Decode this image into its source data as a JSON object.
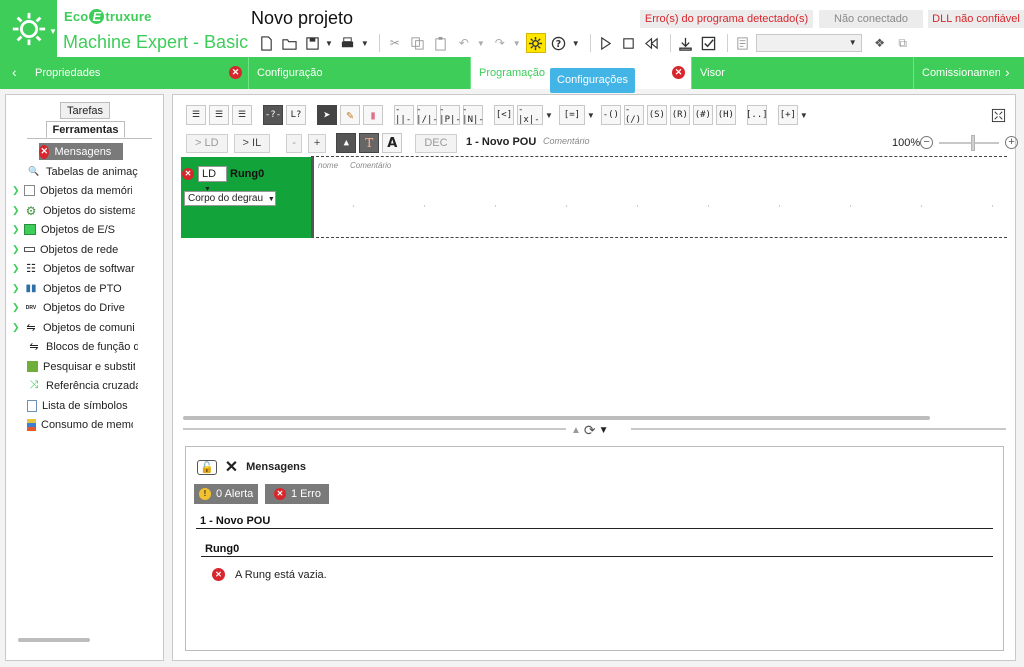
{
  "header": {
    "brand": {
      "pre": "Eco",
      "mark": "E",
      "post": "truxure"
    },
    "product": "Machine Expert - Basic",
    "project_title": "Novo projeto",
    "status": {
      "program_errors": "Erro(s) do programa detectado(s)",
      "connection": "Não conectado",
      "dll": "DLL não confiável"
    },
    "colors": {
      "accent": "#3dcd58",
      "error": "#d8262d",
      "highlight": "#ffe600",
      "info": "#42b4e6"
    }
  },
  "tabs": [
    {
      "label": "Propriedades",
      "error": true
    },
    {
      "label": "Configuração",
      "error": false
    },
    {
      "label": "Programação",
      "error": true,
      "active": true
    },
    {
      "label": "Visor",
      "error": false
    },
    {
      "label": "Comissionament",
      "error": false
    }
  ],
  "tooltip": "Configurações",
  "left_panel": {
    "tabs": {
      "tasks": "Tarefas",
      "tools": "Ferramentas"
    },
    "tree": [
      {
        "label": "Mensagens",
        "icon": "error-icon",
        "selected": true,
        "expandable": false
      },
      {
        "label": "Tabelas de animação",
        "icon": "magnifier-icon",
        "expandable": false
      },
      {
        "label": "Objetos da memória",
        "icon": "memory-icon",
        "expandable": true
      },
      {
        "label": "Objetos do sistema",
        "icon": "gear-icon",
        "expandable": true
      },
      {
        "label": "Objetos de E/S",
        "icon": "io-grid-icon",
        "expandable": true
      },
      {
        "label": "Objetos de rede",
        "icon": "network-icon",
        "expandable": true
      },
      {
        "label": "Objetos de software",
        "icon": "software-icon",
        "expandable": true
      },
      {
        "label": "Objetos de PTO",
        "icon": "pto-icon",
        "expandable": true
      },
      {
        "label": "Objetos do Drive",
        "icon": "drive-icon",
        "expandable": true
      },
      {
        "label": "Objetos de comunicação",
        "icon": "comm-icon",
        "expandable": true
      },
      {
        "label": "Blocos de função definidos",
        "icon": "function-block-icon",
        "expandable": false
      },
      {
        "label": "Pesquisar e substituir",
        "icon": "search-replace-icon",
        "expandable": false
      },
      {
        "label": "Referência cruzada",
        "icon": "cross-reference-icon",
        "expandable": false
      },
      {
        "label": "Lista de símbolos",
        "icon": "symbol-list-icon",
        "expandable": false
      },
      {
        "label": "Consumo de memória",
        "icon": "memory-usage-icon",
        "expandable": false
      }
    ]
  },
  "editor": {
    "buttons": {
      "to_ld": "> LD",
      "to_il": "> IL",
      "minus": "-",
      "plus": "+",
      "dec": "DEC"
    },
    "pou_title": "1 - Novo POU",
    "pou_comment": "Comentário",
    "zoom": "100%",
    "rung": {
      "language": "LD",
      "name": "Rung0",
      "body": "Corpo do degrau",
      "col_name": "nome",
      "col_comment": "Comentário"
    }
  },
  "messages": {
    "title": "Mensagens",
    "warnings": "0 Alerta",
    "errors": "1 Erro",
    "section": "1 - Novo POU",
    "subsection": "Rung0",
    "items": [
      {
        "text": "A Rung está vazia.",
        "icon": "error-icon"
      }
    ]
  }
}
